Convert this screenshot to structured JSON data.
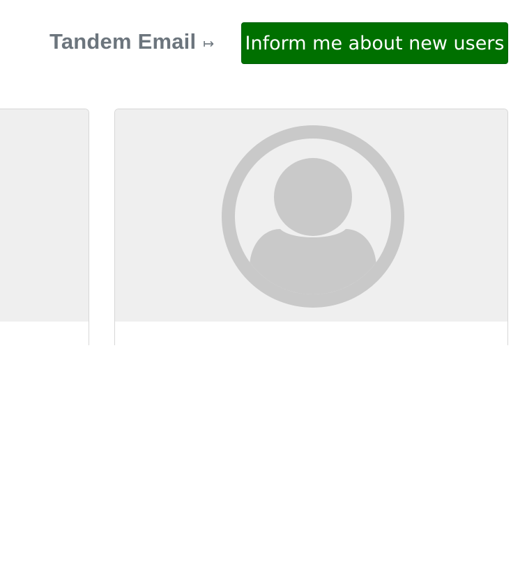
{
  "header": {
    "link_label": "Tandem Email",
    "link_icon": "arrow-right-to-bar-icon",
    "link_icon_glyph": "↦",
    "inform_button_label": "Inform me about new users"
  },
  "colors": {
    "button_bg": "#007000",
    "link_text": "#6c757d",
    "card_image_bg": "#efefef",
    "avatar_gray": "#c9c9c9"
  },
  "cards": [
    {
      "image": "avatar-placeholder"
    },
    {
      "image": "avatar-placeholder-icon"
    }
  ]
}
